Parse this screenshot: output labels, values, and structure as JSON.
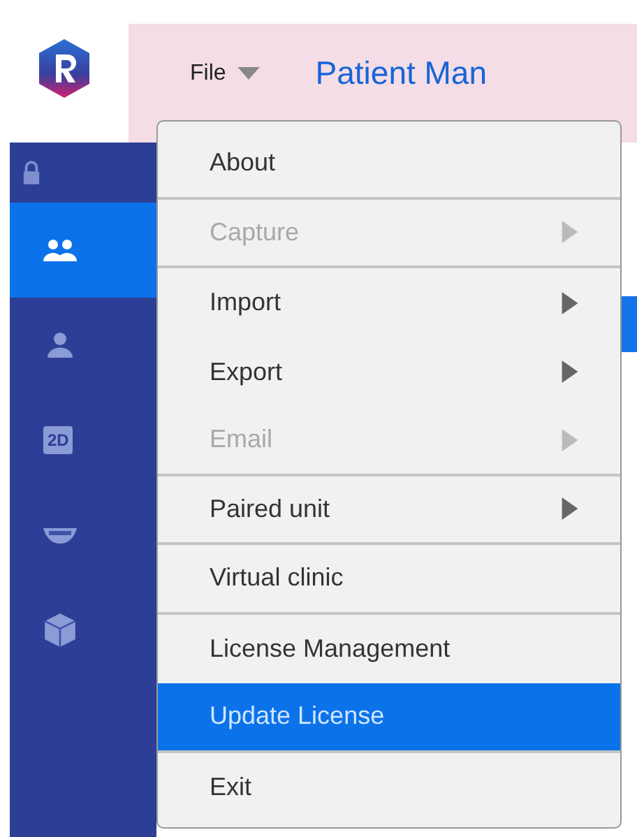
{
  "menu_bar": {
    "label": "File"
  },
  "header": {
    "title": "Patient Man"
  },
  "sidebar": {
    "items": [
      {
        "kind": "people",
        "selected": true
      },
      {
        "kind": "person",
        "selected": false
      },
      {
        "kind": "badge",
        "label": "2D",
        "selected": false
      },
      {
        "kind": "teeth",
        "selected": false
      },
      {
        "kind": "cube",
        "selected": false
      }
    ]
  },
  "file_menu": {
    "items": [
      {
        "label": "About",
        "disabled": false,
        "submenu": false,
        "selected": false,
        "divider_below": true
      },
      {
        "label": "Capture",
        "disabled": true,
        "submenu": true,
        "selected": false,
        "divider_below": true
      },
      {
        "label": "Import",
        "disabled": false,
        "submenu": true,
        "selected": false,
        "divider_below": false
      },
      {
        "label": "Export",
        "disabled": false,
        "submenu": true,
        "selected": false,
        "divider_below": false
      },
      {
        "label": "Email",
        "disabled": true,
        "submenu": true,
        "selected": false,
        "divider_below": true
      },
      {
        "label": "Paired unit",
        "disabled": false,
        "submenu": true,
        "selected": false,
        "divider_below": true
      },
      {
        "label": "Virtual clinic",
        "disabled": false,
        "submenu": false,
        "selected": false,
        "divider_below": true
      },
      {
        "label": "License Management",
        "disabled": false,
        "submenu": false,
        "selected": false,
        "divider_below": false
      },
      {
        "label": "Update License",
        "disabled": false,
        "submenu": false,
        "selected": true,
        "divider_below": true
      },
      {
        "label": "Exit",
        "disabled": false,
        "submenu": false,
        "selected": false,
        "divider_below": false
      }
    ]
  }
}
